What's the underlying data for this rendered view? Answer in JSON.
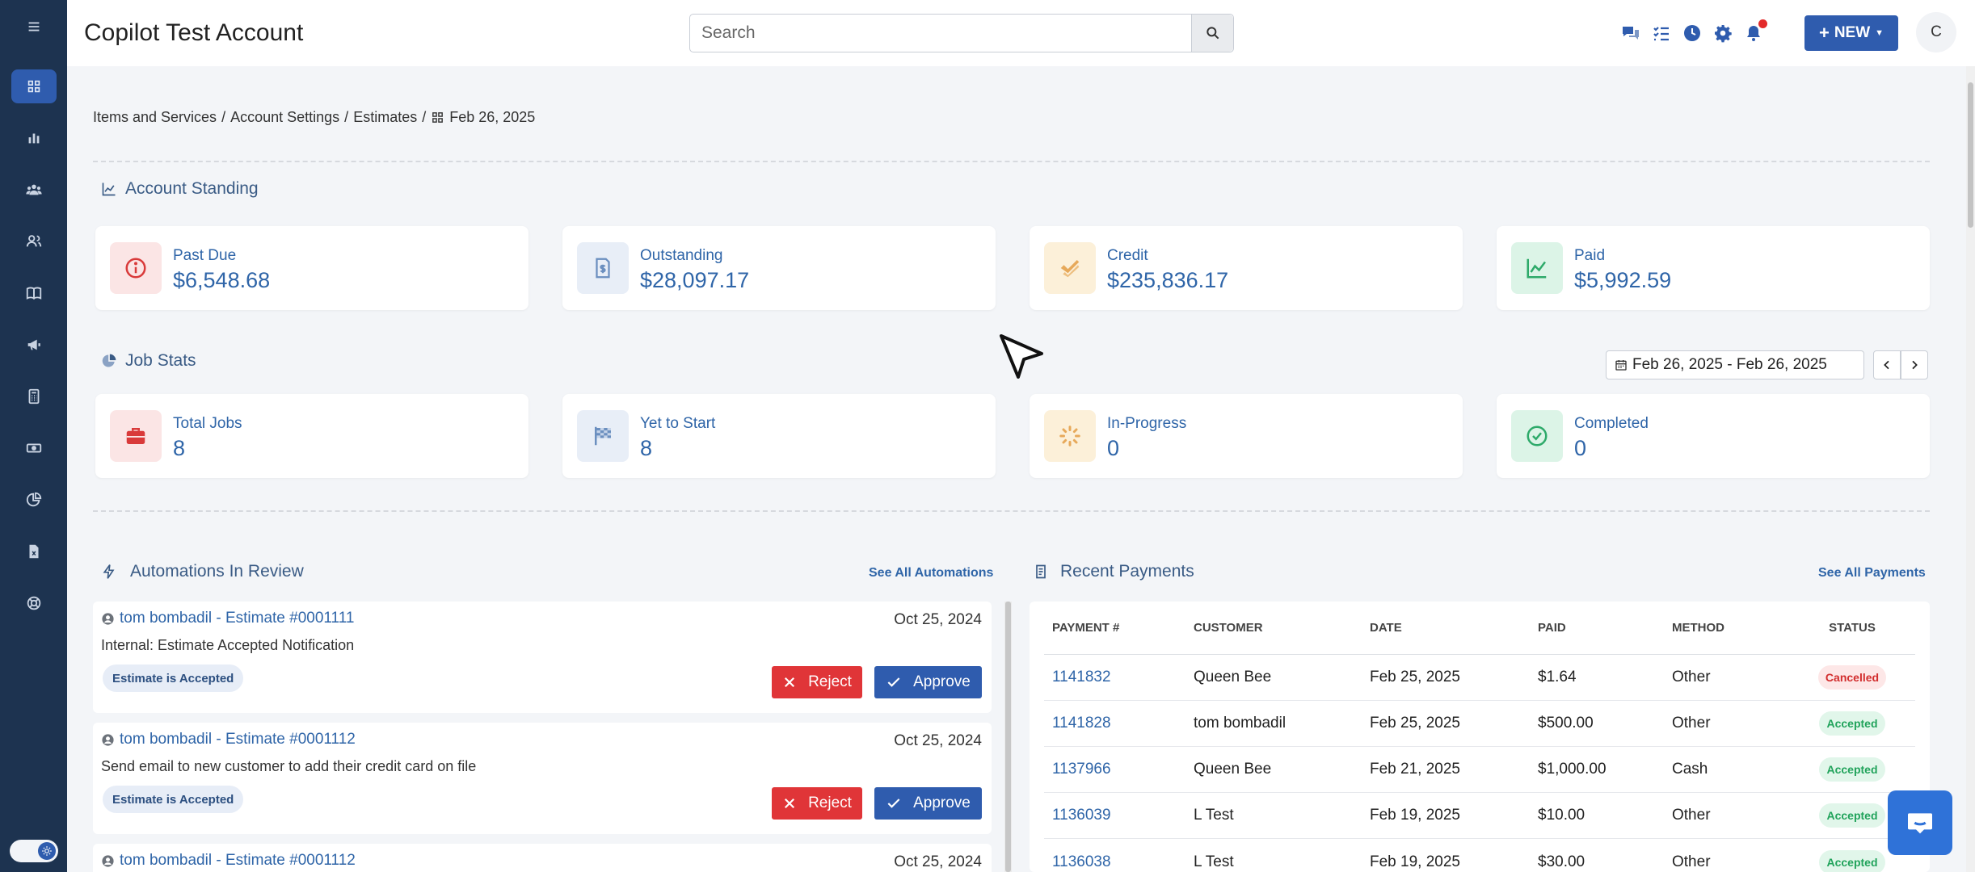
{
  "header": {
    "account_title": "Copilot Test Account",
    "search_placeholder": "Search",
    "new_label": "NEW",
    "avatar_initial": "C"
  },
  "sidebar": {
    "items": [
      "menu-icon",
      "dashboard-icon",
      "reports-icon",
      "team-icon",
      "customers-icon",
      "book-icon",
      "megaphone-icon",
      "calculator-icon",
      "money-icon",
      "pie-chart-icon",
      "document-icon",
      "support-icon"
    ]
  },
  "breadcrumb": {
    "items": [
      "Items and Services",
      "Account Settings",
      "Estimates"
    ],
    "separator": "/",
    "current": "Feb 26, 2025"
  },
  "account_standing": {
    "title": "Account Standing",
    "cards": [
      {
        "label": "Past Due",
        "value": "$6,548.68",
        "color": "#d93a3a"
      },
      {
        "label": "Outstanding",
        "value": "$28,097.17",
        "color": "#6b8fbf"
      },
      {
        "label": "Credit",
        "value": "$235,836.17",
        "color": "#e7a95a"
      },
      {
        "label": "Paid",
        "value": "$5,992.59",
        "color": "#2eaa6a"
      }
    ]
  },
  "job_stats": {
    "title": "Job Stats",
    "date_range": "Feb 26, 2025 - Feb 26, 2025",
    "cards": [
      {
        "label": "Total Jobs",
        "value": "8"
      },
      {
        "label": "Yet to Start",
        "value": "8"
      },
      {
        "label": "In-Progress",
        "value": "0"
      },
      {
        "label": "Completed",
        "value": "0"
      }
    ]
  },
  "automations": {
    "title": "Automations In Review",
    "see_all": "See All Automations",
    "reject_label": "Reject",
    "approve_label": "Approve",
    "items": [
      {
        "title": "tom bombadil - Estimate #0001111",
        "date": "Oct 25, 2024",
        "desc": "Internal: Estimate Accepted Notification",
        "badge": "Estimate is Accepted"
      },
      {
        "title": "tom bombadil - Estimate #0001112",
        "date": "Oct 25, 2024",
        "desc": "Send email to new customer to add their credit card on file",
        "badge": "Estimate is Accepted"
      },
      {
        "title": "tom bombadil - Estimate #0001112",
        "date": "Oct 25, 2024",
        "desc": "",
        "badge": ""
      }
    ]
  },
  "payments": {
    "title": "Recent Payments",
    "see_all": "See All Payments",
    "columns": [
      "PAYMENT #",
      "CUSTOMER",
      "DATE",
      "PAID",
      "METHOD",
      "STATUS"
    ],
    "rows": [
      {
        "id": "1141832",
        "customer": "Queen Bee",
        "date": "Feb 25, 2025",
        "paid": "$1.64",
        "method": "Other",
        "status": "Cancelled"
      },
      {
        "id": "1141828",
        "customer": "tom bombadil",
        "date": "Feb 25, 2025",
        "paid": "$500.00",
        "method": "Other",
        "status": "Accepted"
      },
      {
        "id": "1137966",
        "customer": "Queen Bee",
        "date": "Feb 21, 2025",
        "paid": "$1,000.00",
        "method": "Cash",
        "status": "Accepted"
      },
      {
        "id": "1136039",
        "customer": "L Test",
        "date": "Feb 19, 2025",
        "paid": "$10.00",
        "method": "Other",
        "status": "Accepted"
      },
      {
        "id": "1136038",
        "customer": "L Test",
        "date": "Feb 19, 2025",
        "paid": "$30.00",
        "method": "Other",
        "status": "Accepted"
      }
    ]
  }
}
